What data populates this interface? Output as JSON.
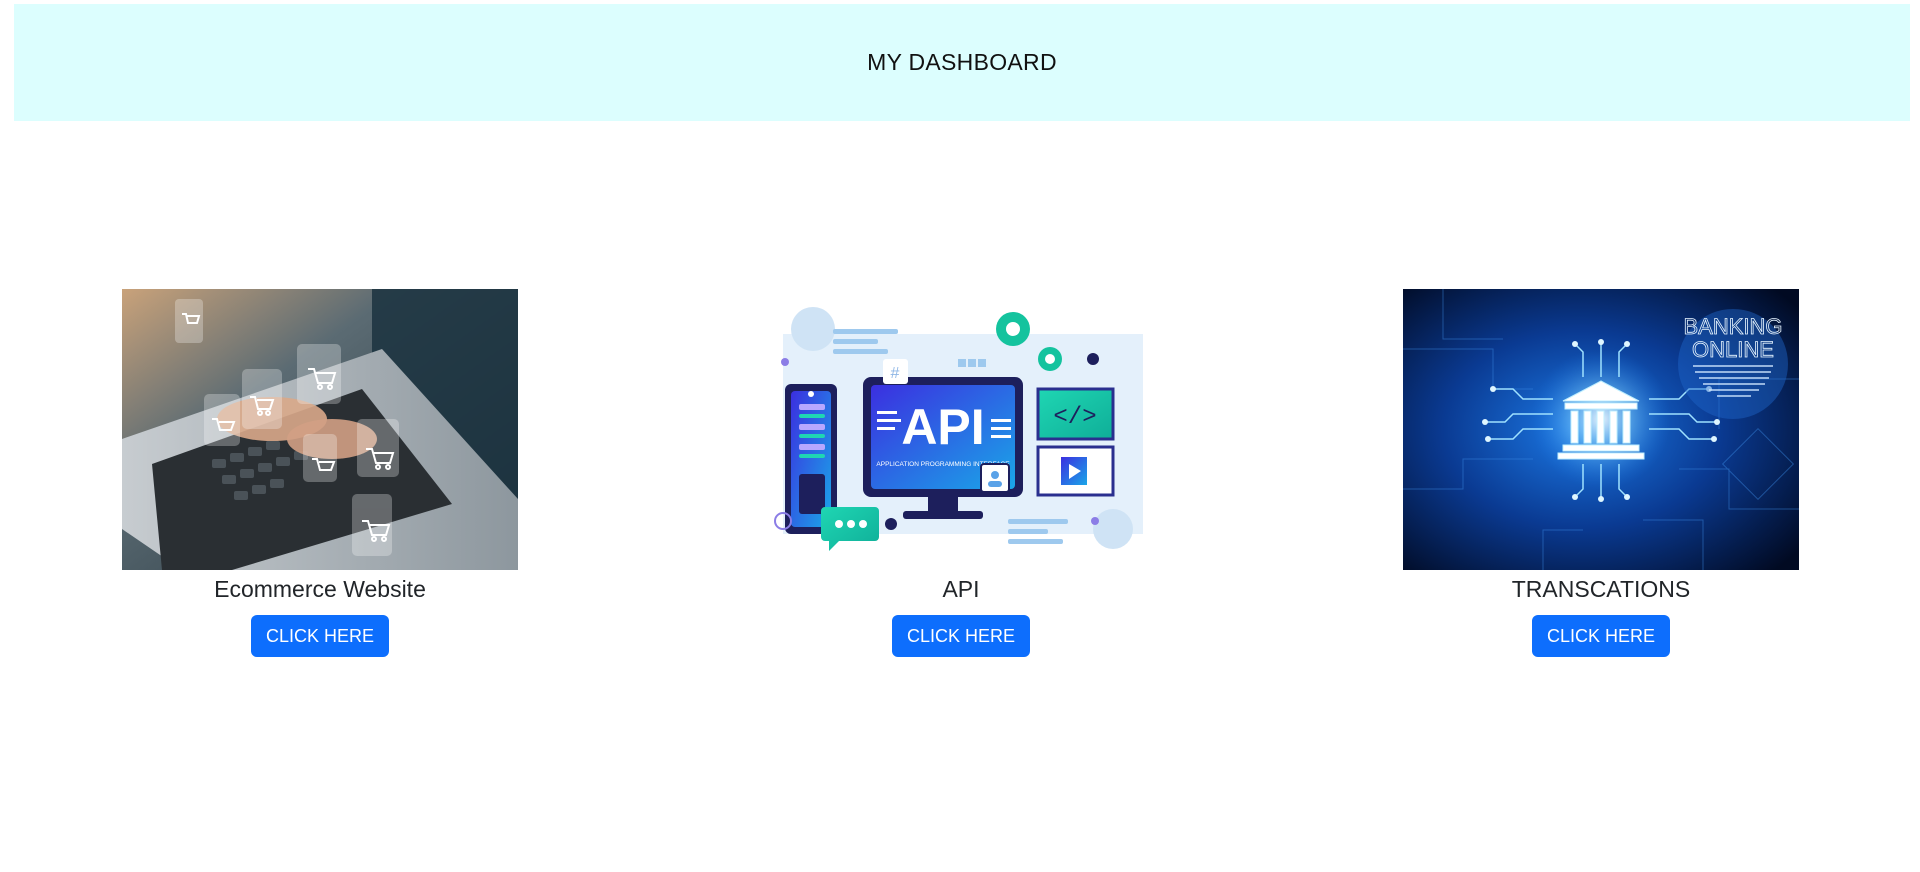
{
  "header": {
    "title": "MY DASHBOARD"
  },
  "cards": [
    {
      "title": "Ecommerce Website",
      "button_label": "CLICK HERE",
      "image_icon": "laptop-shopping-cart-image"
    },
    {
      "title": "API",
      "button_label": "CLICK HERE",
      "image_icon": "api-illustration-image",
      "image_text": {
        "main": "API",
        "sub": "APPLICATION PROGRAMMING INTERFACE"
      }
    },
    {
      "title": "TRANSCATIONS",
      "button_label": "CLICK HERE",
      "image_icon": "online-banking-image",
      "image_text": {
        "line1": "BANKING",
        "line2": "ONLINE"
      }
    }
  ],
  "colors": {
    "header_bg": "#dcfefe",
    "button_bg": "#0d6efd",
    "button_text": "#ffffff"
  }
}
